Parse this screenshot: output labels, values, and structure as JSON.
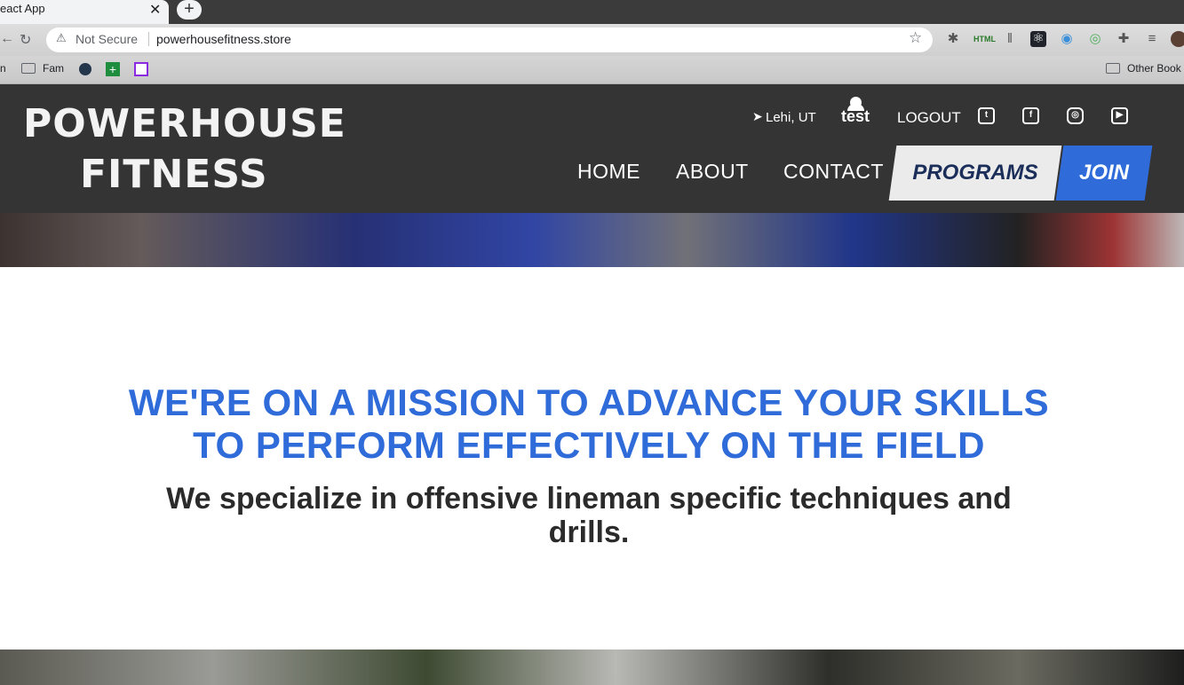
{
  "browser": {
    "tab_title": "eact App",
    "tab_close": "✕",
    "new_tab": "+",
    "back": "←",
    "reload": "↻",
    "security_icon": "⚠",
    "security_label": "Not Secure",
    "url": "powerhousefitness.store",
    "bookmark_star": "☆",
    "extensions": [
      "bug-icon",
      "html-icon",
      "bars-icon",
      "react-icon",
      "edge-icon",
      "circle-icon",
      "puzzle-icon",
      "queue-icon"
    ],
    "bookmarks": {
      "partial": "n",
      "fam": "Fam",
      "other": "Other Book"
    }
  },
  "site": {
    "logo_line1": "POWERHOUSE",
    "logo_line2": "FITNESS",
    "location": "Lehi, UT",
    "location_icon": "➤",
    "user_name": "test",
    "logout": "LOGOUT",
    "social": [
      {
        "name": "twitter",
        "glyph": "t"
      },
      {
        "name": "facebook",
        "glyph": "f"
      },
      {
        "name": "instagram",
        "glyph": "◎"
      },
      {
        "name": "youtube",
        "glyph": "▶"
      }
    ],
    "nav": {
      "home": "HOME",
      "about": "ABOUT",
      "contact": "CONTACT",
      "programs": "PROGRAMS",
      "join": "JOIN"
    },
    "mission_line1": "WE'RE ON A MISSION TO ADVANCE YOUR SKILLS",
    "mission_line2": "TO PERFORM EFFECTIVELY ON THE FIELD",
    "sub_line1": "We specialize in offensive lineman specific techniques and",
    "sub_line2": "drills.",
    "colors": {
      "header_bg": "#353434",
      "accent_blue": "#2f6bd9",
      "programs_bg": "#ebebeb",
      "programs_text": "#1a2e59",
      "body_text": "#2b2b2b"
    }
  }
}
